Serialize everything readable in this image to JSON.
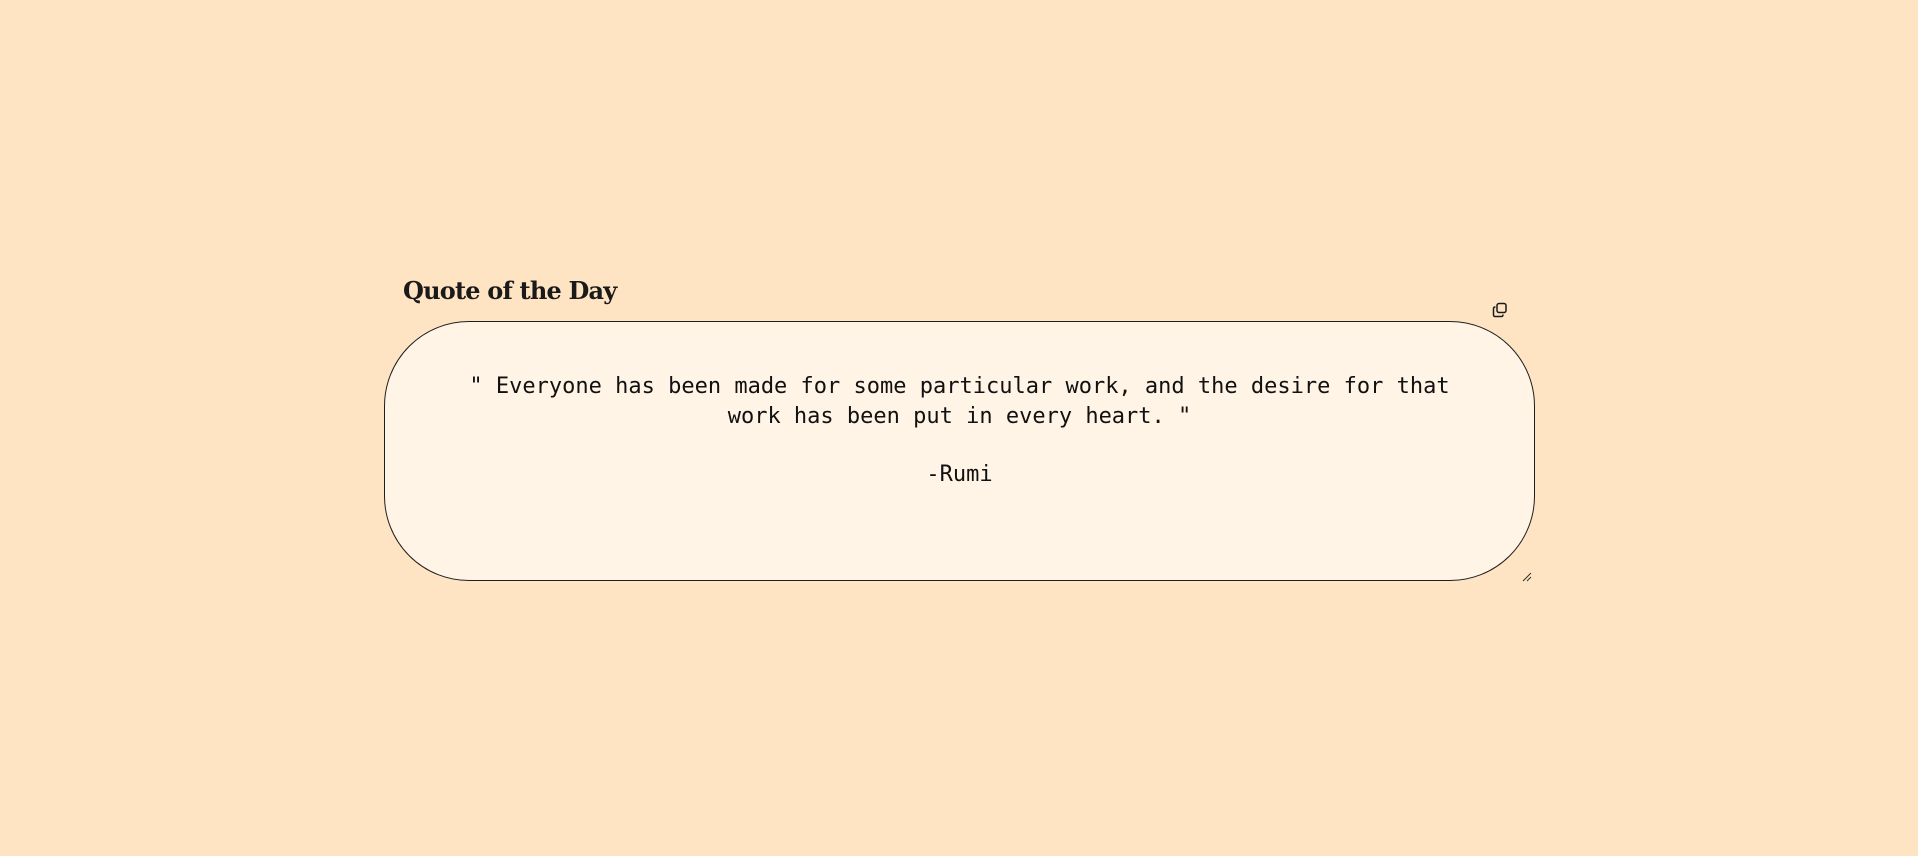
{
  "widget": {
    "title": "Quote of the Day",
    "quote": "\" Everyone has been made for some particular work, and the desire for that work has been put in every heart. \"",
    "author": "-Rumi"
  },
  "icons": {
    "copy": "copy-icon",
    "resize": "resize-handle-icon"
  },
  "colors": {
    "page_background": "#ffe4c4",
    "card_background": "#fff4e5",
    "border": "#1f1f1f",
    "text": "#111111"
  }
}
